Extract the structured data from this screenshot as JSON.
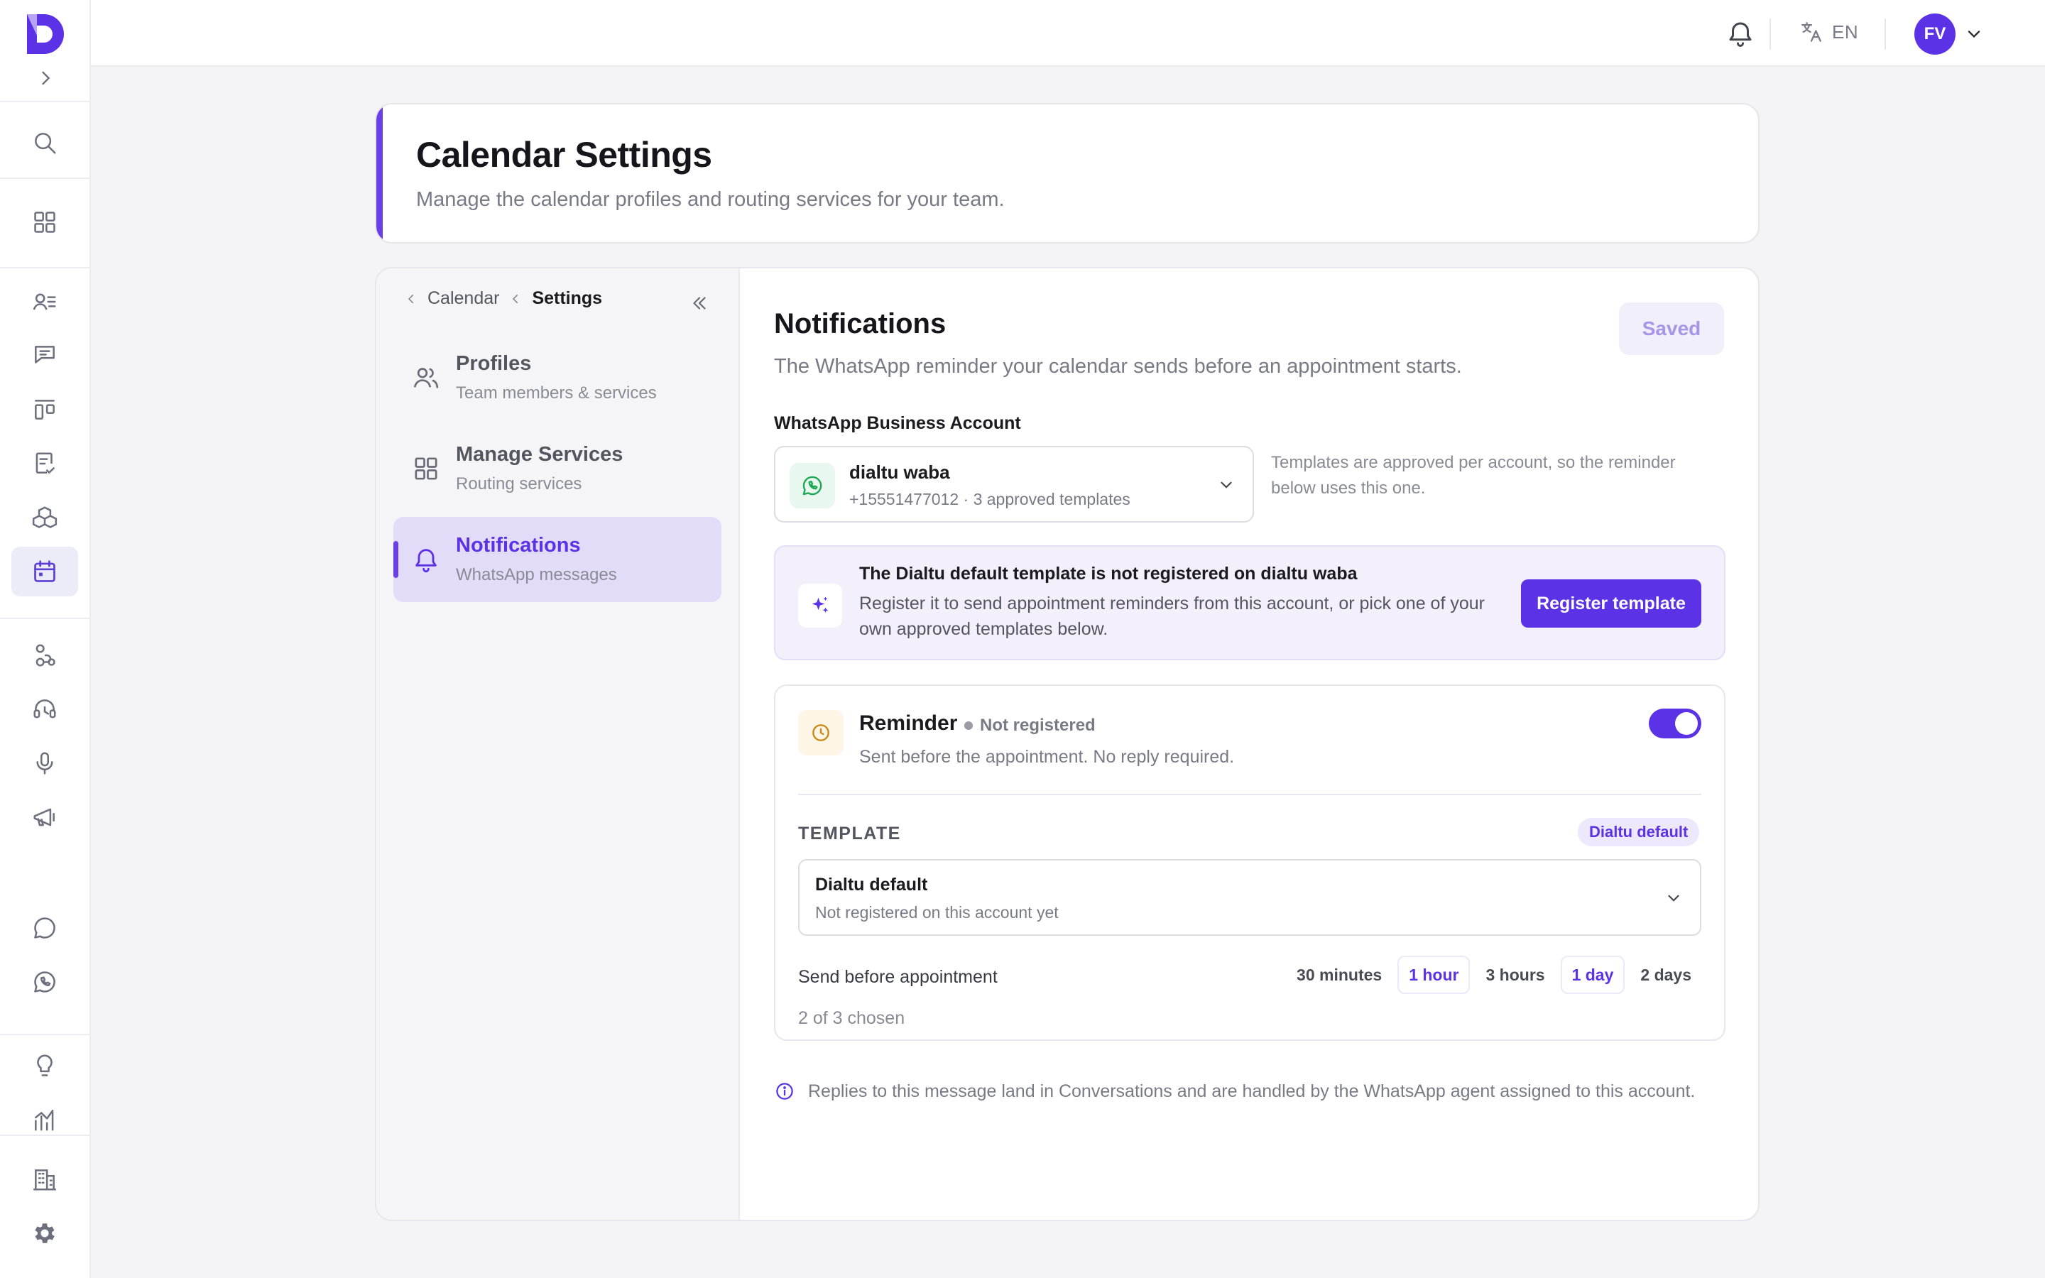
{
  "header": {
    "title": "Calendar Settings",
    "subtitle": "Manage the calendar profiles and routing services for your team."
  },
  "topbar": {
    "language": "EN",
    "avatar_initials": "FV"
  },
  "breadcrumb": {
    "parent": "Calendar",
    "current": "Settings"
  },
  "subnav": {
    "items": [
      {
        "title": "Profiles",
        "subtitle": "Team members & services",
        "icon": "users-icon",
        "active": false
      },
      {
        "title": "Manage Services",
        "subtitle": "Routing services",
        "icon": "grid-icon",
        "active": false
      },
      {
        "title": "Notifications",
        "subtitle": "WhatsApp messages",
        "icon": "bell-icon",
        "active": true
      }
    ]
  },
  "notifications": {
    "title": "Notifications",
    "description": "The WhatsApp reminder your calendar sends before an appointment starts.",
    "saved_label": "Saved",
    "account_label": "WhatsApp Business Account",
    "account": {
      "name": "dialtu waba",
      "meta": "+15551477012 · 3 approved templates"
    },
    "account_note": "Templates are approved per account, so the reminder below uses this one.",
    "banner": {
      "title": "The Dialtu default template is not registered on dialtu waba",
      "body": "Register it to send appointment reminders from this account, or pick one of your own approved templates below.",
      "button": "Register template"
    },
    "reminder": {
      "title": "Reminder",
      "status": "Not registered",
      "subtitle": "Sent before the appointment. No reply required.",
      "enabled": true,
      "template_label": "TEMPLATE",
      "template_badge": "Dialtu default",
      "template": {
        "name": "Dialtu default",
        "meta": "Not registered on this account yet"
      },
      "send_before_label": "Send before appointment",
      "options": [
        {
          "label": "30 minutes",
          "selected": false
        },
        {
          "label": "1 hour",
          "selected": true
        },
        {
          "label": "3 hours",
          "selected": false
        },
        {
          "label": "1 day",
          "selected": true
        },
        {
          "label": "2 days",
          "selected": false
        }
      ],
      "chosen_text": "2 of 3 chosen"
    },
    "footnote": "Replies to this message land in Conversations and are handled by the WhatsApp agent assigned to this account."
  },
  "colors": {
    "accent": "#5b32e6",
    "banner_bg": "#f3f0fc",
    "whatsapp": "#1ea855",
    "reminder_icon": "#c98a17"
  }
}
